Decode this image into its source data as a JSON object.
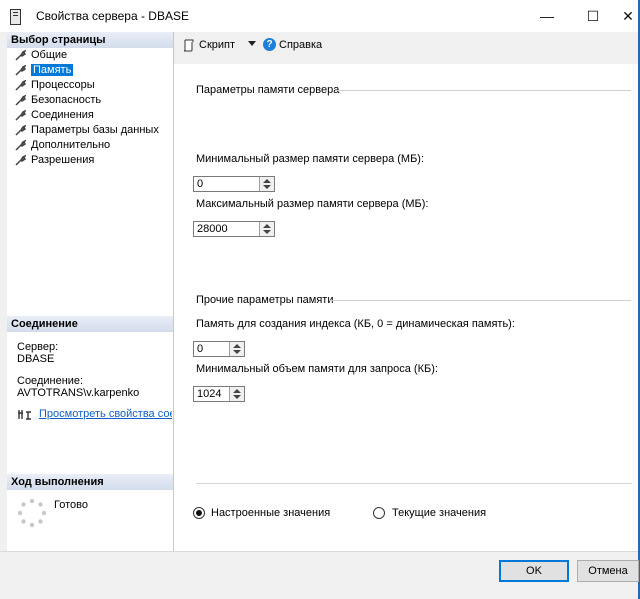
{
  "window": {
    "title": "Свойства сервера - DBASE",
    "controls": {
      "minimize": "—",
      "maximize": "☐",
      "close": "✕"
    }
  },
  "left": {
    "page_select_header": "Выбор страницы",
    "pages": [
      {
        "label": "Общие",
        "selected": false
      },
      {
        "label": "Память",
        "selected": true
      },
      {
        "label": "Процессоры",
        "selected": false
      },
      {
        "label": "Безопасность",
        "selected": false
      },
      {
        "label": "Соединения",
        "selected": false
      },
      {
        "label": "Параметры базы данных",
        "selected": false
      },
      {
        "label": "Дополнительно",
        "selected": false
      },
      {
        "label": "Разрешения",
        "selected": false
      }
    ],
    "connection_header": "Соединение",
    "server_label": "Сервер:",
    "server_value": "DBASE",
    "connection_label": "Соединение:",
    "connection_value": "AVTOTRANS\\v.karpenko",
    "view_props_link": "Просмотреть свойства соед",
    "progress_header": "Ход выполнения",
    "progress_status": "Готово"
  },
  "toolbar": {
    "script_label": "Скрипт",
    "help_label": "Справка"
  },
  "memory": {
    "group1_title": "Параметры памяти сервера",
    "min_label": "Минимальный размер памяти сервера (МБ):",
    "min_value": "0",
    "max_label": "Максимальный размер памяти сервера (МБ):",
    "max_value": "28000",
    "group2_title": "Прочие параметры памяти",
    "index_label": "Память для создания индекса (КБ, 0 = динамическая память):",
    "index_value": "0",
    "query_label": "Минимальный объем памяти для запроса (КБ):",
    "query_value": "1024"
  },
  "radios": {
    "configured_label": "Настроенные значения",
    "current_label": "Текущие значения",
    "selected": "configured"
  },
  "buttons": {
    "ok": "OK",
    "cancel": "Отмена"
  }
}
